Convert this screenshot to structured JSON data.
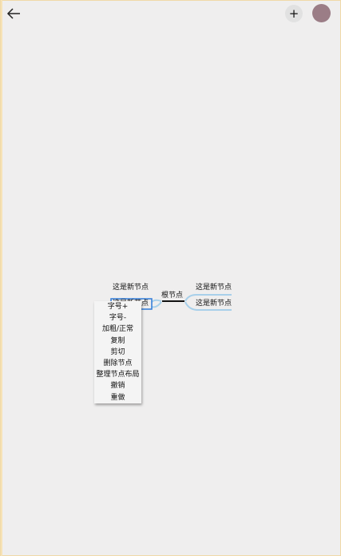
{
  "toolbar": {
    "back_icon": "arrow-left-icon",
    "add_label": "+",
    "accent_color": "#9b7d86"
  },
  "mindmap": {
    "root": "根节点",
    "left_nodes": [
      "这是新节点",
      "这是新节点"
    ],
    "right_nodes": [
      "这是新节点",
      "这是新节点"
    ]
  },
  "context_menu": {
    "items": [
      "字号+",
      "字号-",
      "加粗/正常",
      "复制",
      "剪切",
      "删除节点",
      "整理节点布局",
      "撤销",
      "重做"
    ]
  }
}
